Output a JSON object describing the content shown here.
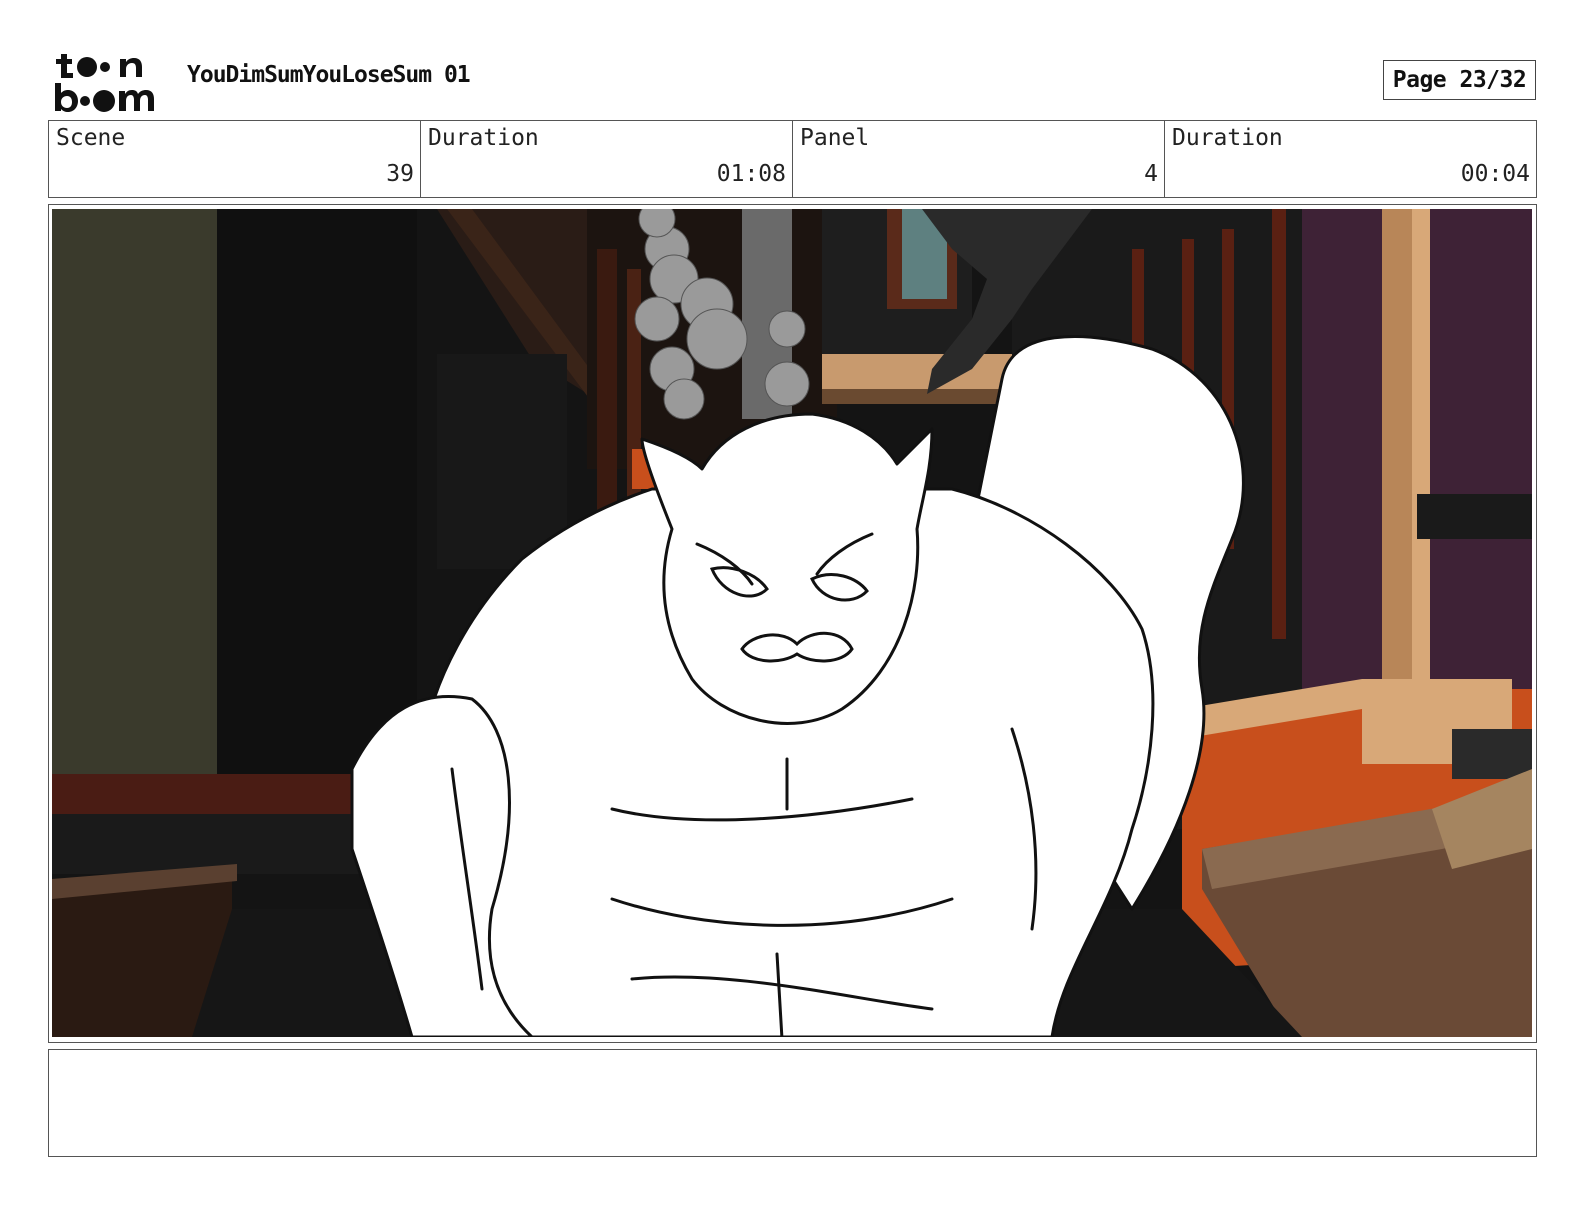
{
  "header": {
    "logo_text": "toon boom",
    "project_title": "YouDimSumYouLoseSum 01",
    "page_label": "Page 23/32"
  },
  "info": {
    "scene_label": "Scene",
    "scene_value": "39",
    "scene_duration_label": "Duration",
    "scene_duration_value": "01:08",
    "panel_label": "Panel",
    "panel_value": "4",
    "panel_duration_label": "Duration",
    "panel_duration_value": "00:04"
  },
  "panel": {
    "image_subject": "storyboard-sketch-cat-character-in-alley"
  },
  "notes": {
    "text": ""
  },
  "colors": {
    "frame_border": "#555555",
    "orange_accent": "#c84f1c",
    "purple_wall": "#3e2236",
    "tan_wood": "#c89a6e"
  }
}
